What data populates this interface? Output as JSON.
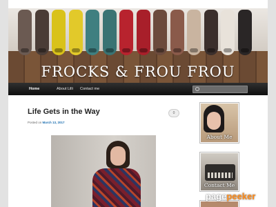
{
  "site": {
    "title": "FROCKS & FROU FROU"
  },
  "nav": {
    "items": [
      {
        "label": "Home",
        "active": true
      },
      {
        "label": "About Lilli",
        "active": false
      },
      {
        "label": "Contact me",
        "active": false
      }
    ],
    "search_placeholder": ""
  },
  "post": {
    "title": "Life Gets in the Way",
    "meta_prefix": "Posted on",
    "date": "March 13, 2017",
    "comment_count": "0"
  },
  "sidebar": {
    "widgets": [
      {
        "label": "About Me"
      },
      {
        "label": "Contact Me"
      }
    ]
  },
  "watermark": {
    "part1": "page",
    "part2": "peeker"
  },
  "colors": {
    "shoes": [
      "#6b5a52",
      "#4a3c36",
      "#d9c21a",
      "#e2c92a",
      "#3f7f80",
      "#3a7373",
      "#b8232e",
      "#a81f2a",
      "#6b4a3c",
      "#8a5a4a",
      "#c9b4a0",
      "#3b2f2c",
      "#e8e2da",
      "#2a2626"
    ]
  }
}
